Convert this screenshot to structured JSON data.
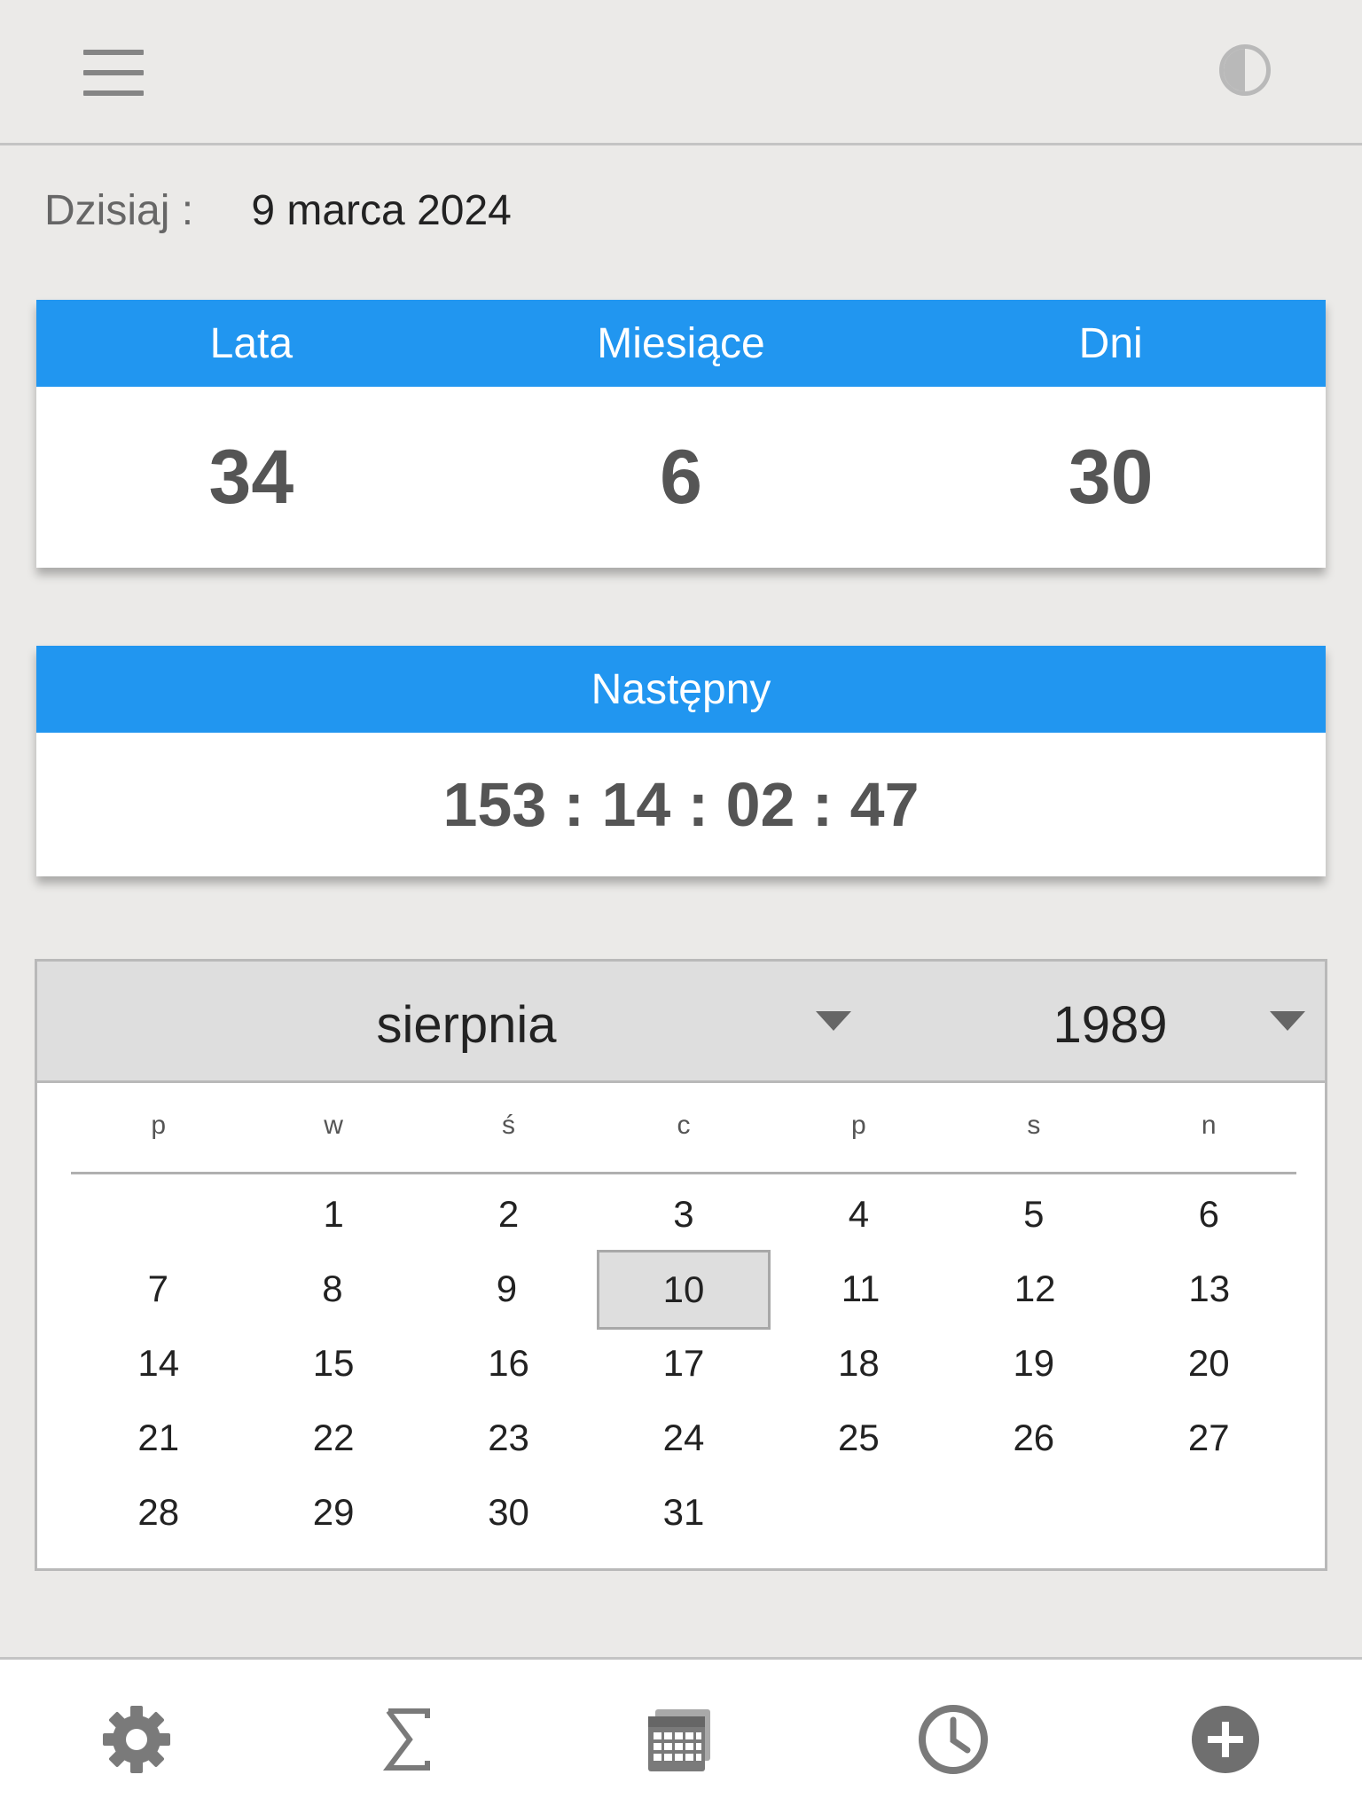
{
  "header": {
    "menu_icon": "hamburger-menu-icon",
    "theme_icon": "contrast-icon"
  },
  "today": {
    "label": "Dzisiaj :",
    "value": "9 marca 2024"
  },
  "age_card": {
    "columns": [
      {
        "label": "Lata",
        "value": "34"
      },
      {
        "label": "Miesiące",
        "value": "6"
      },
      {
        "label": "Dni",
        "value": "30"
      }
    ],
    "header_color": "#2196f0"
  },
  "next_card": {
    "label": "Następny",
    "countdown": "153 : 14 : 02 : 47"
  },
  "calendar": {
    "month": "sierpnia",
    "year": "1989",
    "weekdays": [
      "p",
      "w",
      "ś",
      "c",
      "p",
      "s",
      "n"
    ],
    "weeks": [
      [
        "",
        "1",
        "2",
        "3",
        "4",
        "5",
        "6"
      ],
      [
        "7",
        "8",
        "9",
        "10",
        "11",
        "12",
        "13"
      ],
      [
        "14",
        "15",
        "16",
        "17",
        "18",
        "19",
        "20"
      ],
      [
        "21",
        "22",
        "23",
        "24",
        "25",
        "26",
        "27"
      ],
      [
        "28",
        "29",
        "30",
        "31",
        "",
        "",
        ""
      ]
    ],
    "selected_day": "10"
  },
  "bottom_nav": {
    "items": [
      "settings-gear-icon",
      "sum-sigma-icon",
      "calendar-icon",
      "clock-icon",
      "add-circle-icon"
    ]
  }
}
